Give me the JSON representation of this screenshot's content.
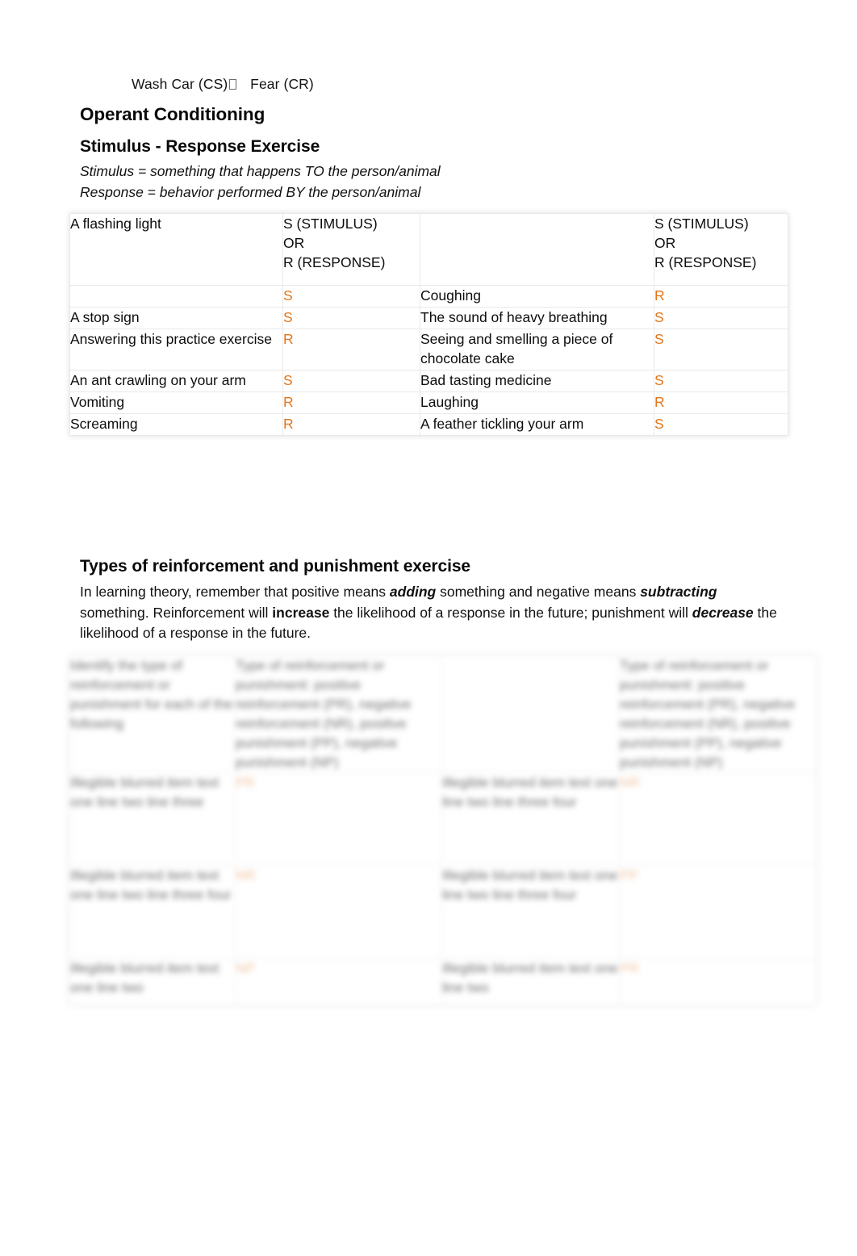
{
  "document": {
    "carryover_line": {
      "before": "Wash Car (CS)",
      "glyph": "missing-glyph-box",
      "after": "Fear (CR)"
    },
    "headings": {
      "operant_conditioning": "Operant Conditioning",
      "stimulus_response": "Stimulus - Response Exercise",
      "types_exercise": "Types of reinforcement and punishment exercise"
    },
    "definitions": {
      "stimulus": "Stimulus = something that happens TO the person/animal",
      "response": "Response = behavior performed BY the person/animal"
    },
    "paragraph": {
      "p1": "In learning theory, remember that positive means ",
      "em1": "adding",
      "p2": " something and negative means ",
      "em2": "subtracting",
      "p3": " something. Reinforcement will ",
      "em3": "increase",
      "p4": " the likelihood of a response in the future; punishment will ",
      "em4": "decrease",
      "p5": " the likelihood of a response in the future."
    },
    "accent_color": "#e3761c",
    "stimulus_response_table": {
      "header": {
        "col1": "",
        "col2": "S (STIMULUS)\nOR\nR (RESPONSE)",
        "col3": "",
        "col4": "S (STIMULUS)\nOR\nR (RESPONSE)",
        "col1_inline_item": "A flashing light"
      },
      "rows": [
        {
          "left_item": "",
          "left_answer": "S",
          "right_item": "Coughing",
          "right_answer": "R"
        },
        {
          "left_item": "A stop sign",
          "left_answer": "S",
          "right_item": "The sound of heavy breathing",
          "right_answer": "S"
        },
        {
          "left_item": "Answering this practice exercise",
          "left_answer": "R",
          "right_item": "Seeing and smelling a piece of chocolate cake",
          "right_answer": "S"
        },
        {
          "left_item": "An ant crawling on your arm",
          "left_answer": "S",
          "right_item": "Bad tasting medicine",
          "right_answer": "S"
        },
        {
          "left_item": "Vomiting",
          "left_answer": "R",
          "right_item": "Laughing",
          "right_answer": "R"
        },
        {
          "left_item": "Screaming",
          "left_answer": "R",
          "right_item": "A feather tickling your arm",
          "right_answer": "S"
        }
      ]
    },
    "reinforcement_punishment_table": {
      "note": "contents visually blurred / illegible in the screenshot",
      "header": {
        "col1": "Identify the type of reinforcement or punishment for each of the following",
        "col2": "Type of reinforcement or punishment: positive reinforcement (PR), negative reinforcement (NR), positive punishment (PP), negative punishment (NP)",
        "col3": "",
        "col4": "Type of reinforcement or punishment: positive reinforcement (PR), negative reinforcement (NR), positive punishment (PP), negative punishment (NP)"
      },
      "rows": [
        {
          "left_item": "Illegible blurred item text one line two line three",
          "left_answer": "PR",
          "right_item": "Illegible blurred item text one line two line three four",
          "right_answer": "NR"
        },
        {
          "left_item": "Illegible blurred item text one line two line three four",
          "left_answer": "NR",
          "right_item": "Illegible blurred item text one line two line three four",
          "right_answer": "PP"
        },
        {
          "left_item": "Illegible blurred item text one line two",
          "left_answer": "NP",
          "right_item": "Illegible blurred item text one line two",
          "right_answer": "PR"
        }
      ]
    }
  }
}
